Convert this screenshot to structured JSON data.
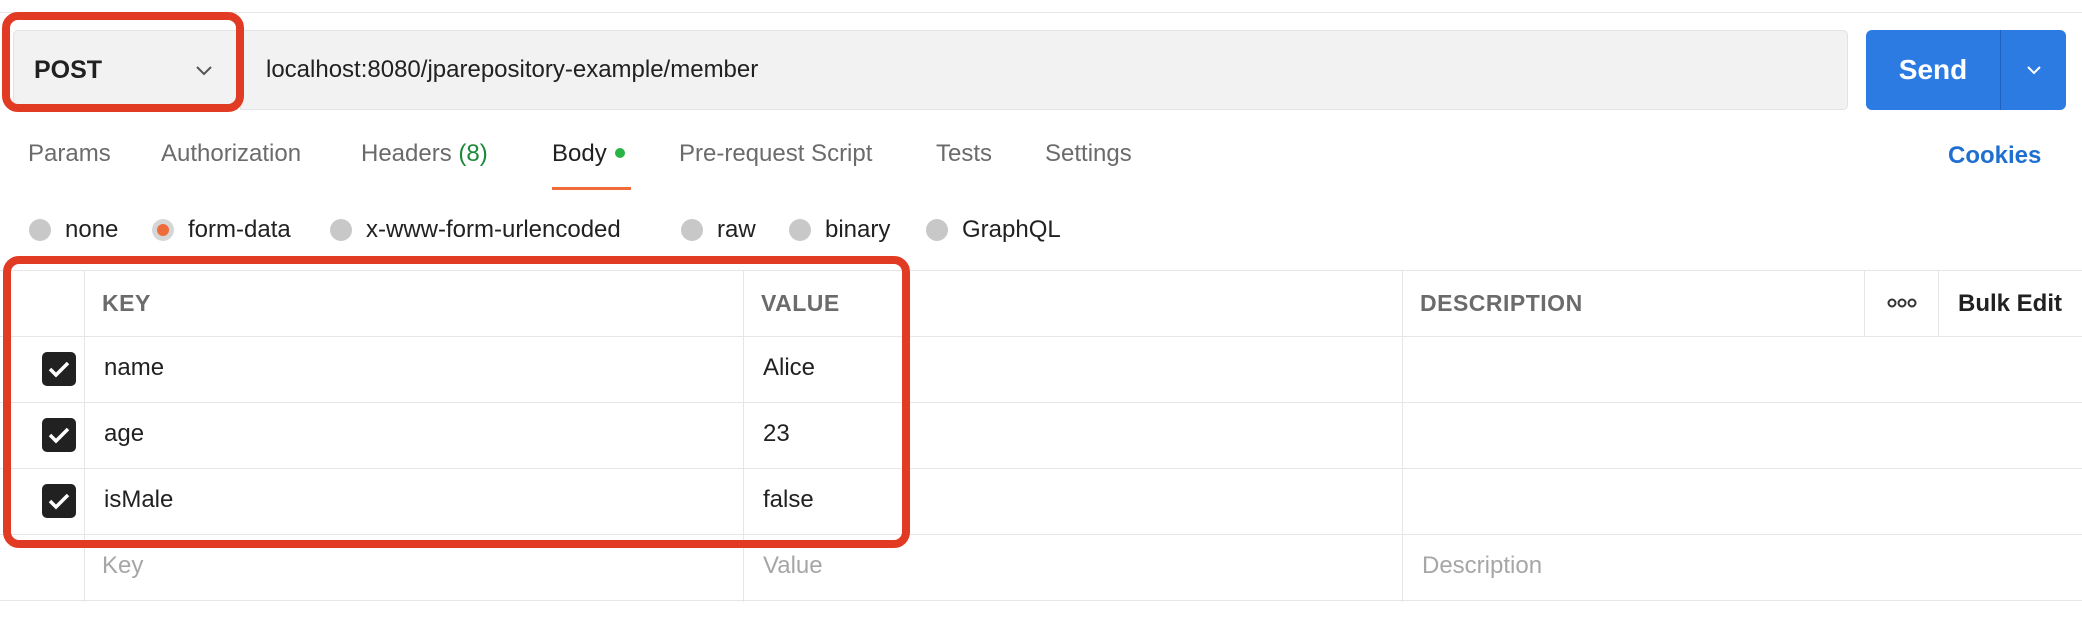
{
  "request": {
    "method": "POST",
    "url": "localhost:8080/jparepository-example/member",
    "send_label": "Send"
  },
  "tabs": {
    "params": "Params",
    "authorization": "Authorization",
    "headers": "Headers",
    "headers_count": "(8)",
    "body": "Body",
    "pre_request": "Pre-request Script",
    "tests": "Tests",
    "settings": "Settings",
    "cookies": "Cookies"
  },
  "body_types": {
    "none": "none",
    "form_data": "form-data",
    "urlencoded": "x-www-form-urlencoded",
    "raw": "raw",
    "binary": "binary",
    "graphql": "GraphQL",
    "selected": "form-data"
  },
  "table": {
    "headers": {
      "key": "KEY",
      "value": "VALUE",
      "description": "DESCRIPTION",
      "bulk_edit": "Bulk Edit"
    },
    "rows": [
      {
        "key": "name",
        "value": "Alice",
        "checked": true
      },
      {
        "key": "age",
        "value": "23",
        "checked": true
      },
      {
        "key": "isMale",
        "value": "false",
        "checked": true
      }
    ],
    "placeholders": {
      "key": "Key",
      "value": "Value",
      "description": "Description"
    }
  },
  "colors": {
    "send_button": "#2b7be3",
    "active_tab_underline": "#ef6b3a",
    "body_dot": "#28b346",
    "cookies_link": "#1f6fd1",
    "annotation": "#e23b24"
  },
  "icons": {
    "method_dropdown": "chevron-down-icon",
    "send_dropdown": "chevron-down-icon",
    "row_checkbox": "checkmark-icon",
    "table_options": "more-horizontal-icon"
  }
}
